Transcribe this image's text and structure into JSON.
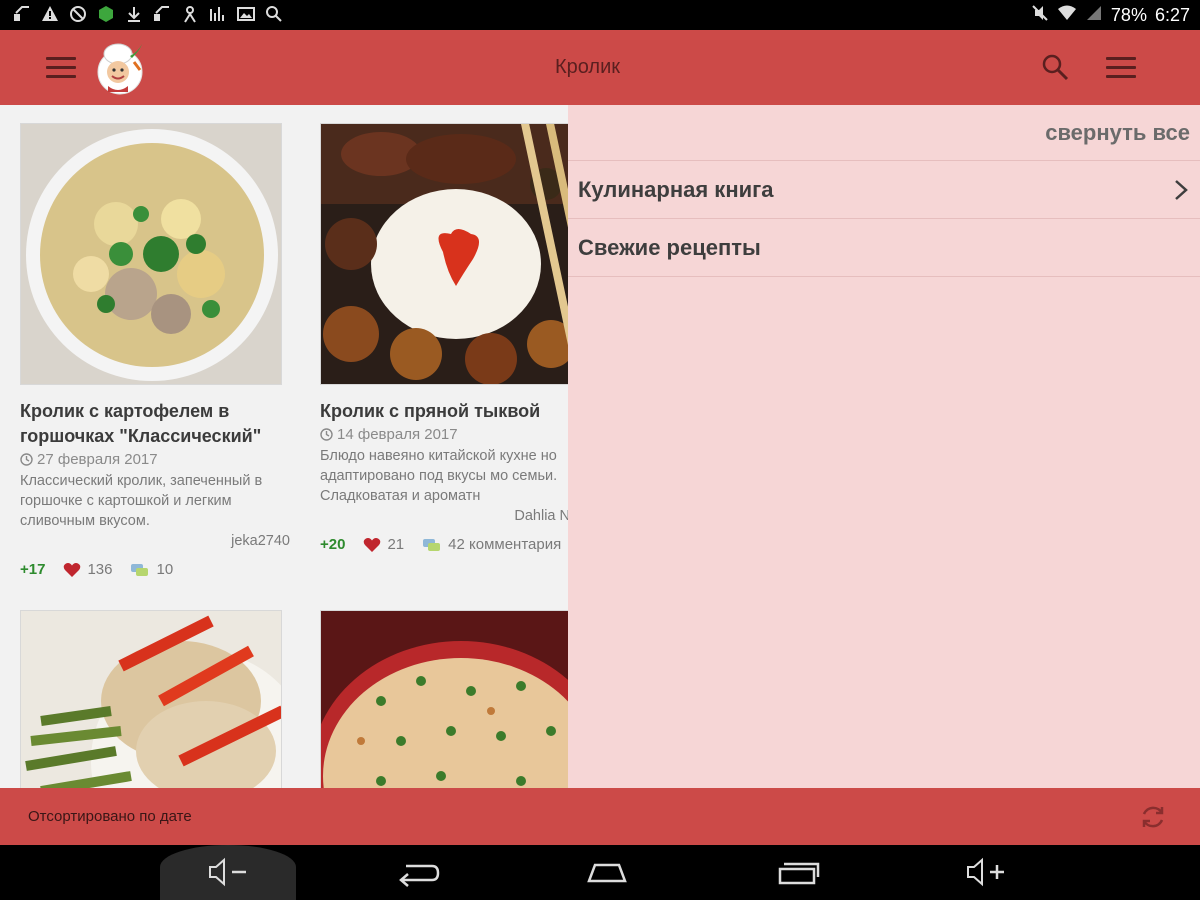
{
  "status_bar": {
    "battery": "78%",
    "time": "6:27",
    "left_icons": [
      "notification-icon",
      "warning-icon",
      "block-icon",
      "shield-icon",
      "download-icon",
      "notification-icon",
      "person-icon",
      "signal-icon",
      "image-icon",
      "search-icon"
    ],
    "right_icons": [
      "mute-icon",
      "wifi-icon",
      "cellular-icon"
    ]
  },
  "appbar": {
    "title": "Кролик",
    "bg_color": "#cc4a48"
  },
  "recipes": [
    {
      "title": "Кролик с картофелем в горшочках \"Классический\"",
      "date": "27 февраля 2017",
      "description": "Классический кролик, запеченный в горшочке с картошкой и легким сливочным вкусом.",
      "author": "jeka2740",
      "score": "+17",
      "likes": "136",
      "comments": "10"
    },
    {
      "title": "Кролик с пряной тыквой",
      "date": "14 февраля 2017",
      "description": "Блюдо навеяно китайской кухне но адаптировано под вкусы мо семьи. Сладковатая и ароматн",
      "author": "Dahlia N",
      "score": "+20",
      "likes": "21",
      "comments": "42 комментария"
    }
  ],
  "drawer": {
    "collapse_all": "свернуть все",
    "items": [
      {
        "label": "Кулинарная книга",
        "has_chevron": true
      },
      {
        "label": "Свежие рецепты",
        "has_chevron": false
      }
    ],
    "bg_color": "#f6d6d6"
  },
  "bottombar": {
    "sort_label": "Отсортировано по дате"
  },
  "navbar": {
    "buttons": [
      "volume-down-icon",
      "back-icon",
      "home-icon",
      "recents-icon",
      "volume-up-icon"
    ]
  }
}
